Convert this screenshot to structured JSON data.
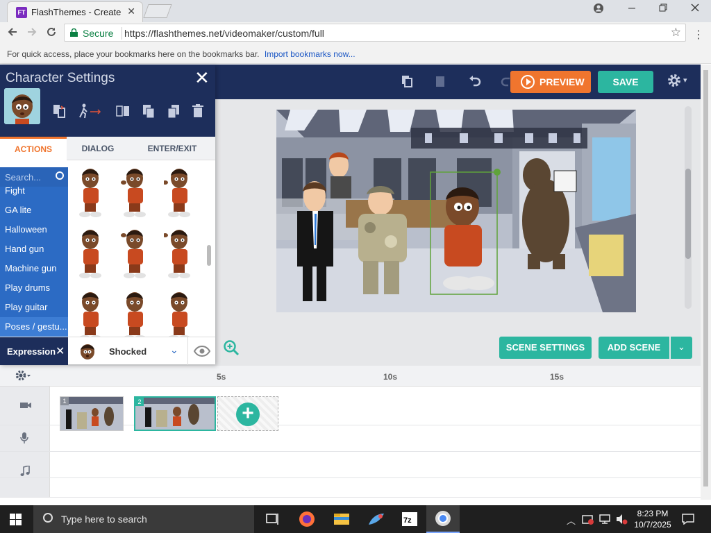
{
  "browser": {
    "tab_title": "FlashThemes - Create",
    "tab_close": "✕",
    "favicon_text": "FT",
    "secure_label": "Secure",
    "url": "https://flashthemes.net/videomaker/custom/full",
    "bookmarks_text": "For quick access, place your bookmarks here on the bookmarks bar.",
    "bookmarks_link": "Import bookmarks now..."
  },
  "toolbar": {
    "preview_label": "PREVIEW",
    "save_label": "SAVE",
    "settings_caret": "▾"
  },
  "character_panel": {
    "title": "Character Settings",
    "close": "✕",
    "tabs": [
      "ACTIONS",
      "DIALOG",
      "ENTER/EXIT"
    ],
    "search_placeholder": "Search...",
    "categories": [
      "Fight",
      "GA lite",
      "Halloween",
      "Hand gun",
      "Machine gun",
      "Play drums",
      "Play guitar",
      "Poses / gestu..."
    ],
    "selected_category": "Poses / gestu...",
    "expression_label": "Expression",
    "expression_close": "✕",
    "expression_value": "Shocked",
    "expression_chevron": "⌄"
  },
  "stage_buttons": {
    "scene_settings": "SCENE SETTINGS",
    "add_scene": "ADD SCENE",
    "add_scene_caret": "⌄"
  },
  "timeline": {
    "ticks": [
      "5s",
      "10s",
      "15s"
    ],
    "scenes": [
      {
        "number": "1"
      },
      {
        "number": "2"
      }
    ],
    "add_symbol": "+"
  },
  "taskbar": {
    "search_placeholder": "Type here to search",
    "time": "8:23 PM",
    "date": "10/7/2025"
  },
  "colors": {
    "navy": "#1d2e5b",
    "orange": "#f0752e",
    "teal": "#2cb6a0",
    "blue": "#2c6bc4"
  }
}
